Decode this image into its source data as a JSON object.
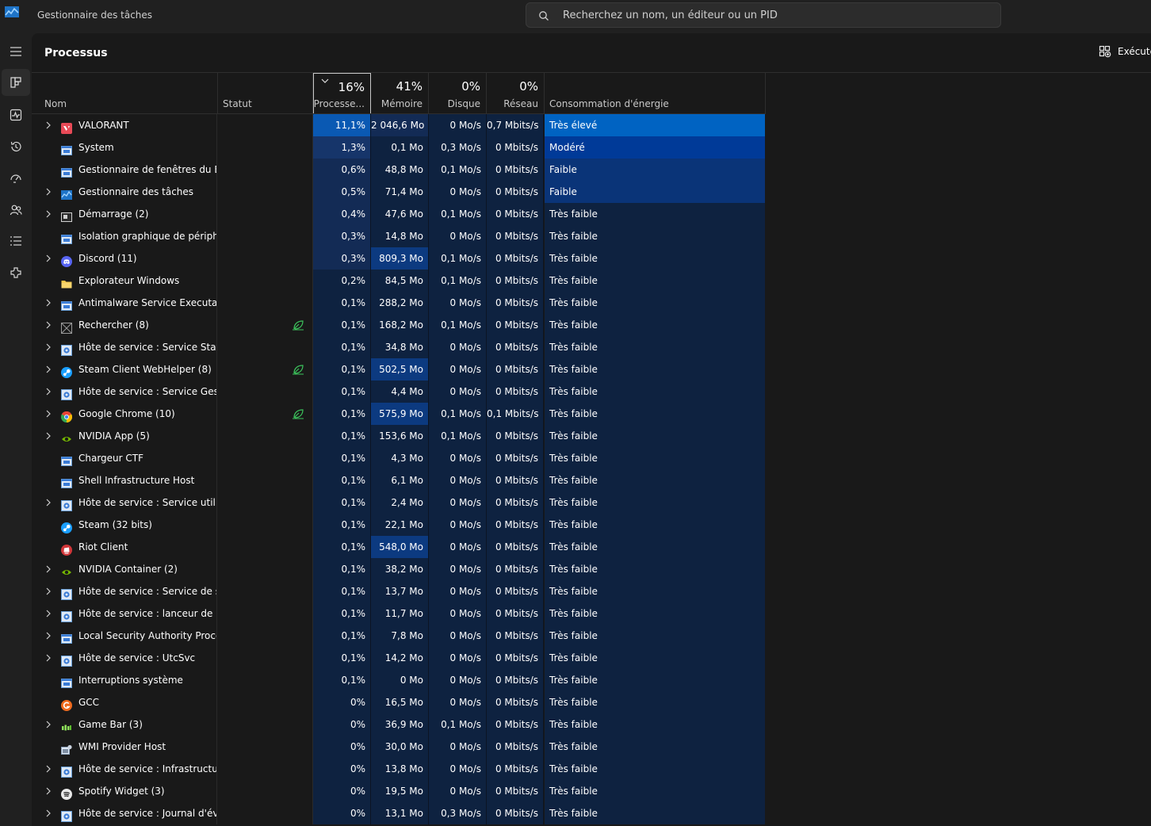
{
  "window": {
    "title": "Gestionnaire des tâches"
  },
  "search": {
    "placeholder": "Recherchez un nom, un éditeur ou un PID"
  },
  "page": {
    "title": "Processus",
    "run_task_label": "Exécute"
  },
  "nav_icons": [
    "hamburger-icon",
    "processes-icon",
    "performance-icon",
    "app-history-icon",
    "startup-apps-icon",
    "users-icon",
    "details-icon",
    "services-icon"
  ],
  "columns": {
    "name": "Nom",
    "status": "Statut",
    "cpu": {
      "pct": "16%",
      "label": "Processe..."
    },
    "memory": {
      "pct": "41%",
      "label": "Mémoire"
    },
    "disk": {
      "pct": "0%",
      "label": "Disque"
    },
    "network": {
      "pct": "0%",
      "label": "Réseau"
    },
    "power": "Consommation d'énergie"
  },
  "colors": {
    "accent": "#0063c2",
    "eco_leaf": "#3cc45c"
  },
  "processes": [
    {
      "name": "VALORANT",
      "expandable": true,
      "icon": "valorant",
      "eco": false,
      "cpu": "11,1%",
      "mem": "2 046,6 Mo",
      "disk": "0 Mo/s",
      "net": "0,7 Mbits/s",
      "power": "Très élevé",
      "cpu_lvl": 4,
      "mem_lvl": 1,
      "pwr_lvl": 4
    },
    {
      "name": "System",
      "expandable": false,
      "icon": "window",
      "eco": false,
      "cpu": "1,3%",
      "mem": "0,1 Mo",
      "disk": "0,3 Mo/s",
      "net": "0 Mbits/s",
      "power": "Modéré",
      "cpu_lvl": 2,
      "mem_lvl": 0,
      "pwr_lvl": 3
    },
    {
      "name": "Gestionnaire de fenêtres du B...",
      "expandable": false,
      "icon": "window",
      "eco": false,
      "cpu": "0,6%",
      "mem": "48,8 Mo",
      "disk": "0,1 Mo/s",
      "net": "0 Mbits/s",
      "power": "Faible",
      "cpu_lvl": 1,
      "mem_lvl": 0,
      "pwr_lvl": 2
    },
    {
      "name": "Gestionnaire des tâches",
      "expandable": true,
      "icon": "taskmgr",
      "eco": false,
      "cpu": "0,5%",
      "mem": "71,4 Mo",
      "disk": "0 Mo/s",
      "net": "0 Mbits/s",
      "power": "Faible",
      "cpu_lvl": 1,
      "mem_lvl": 0,
      "pwr_lvl": 2
    },
    {
      "name": "Démarrage (2)",
      "expandable": true,
      "icon": "startup",
      "eco": false,
      "cpu": "0,4%",
      "mem": "47,6 Mo",
      "disk": "0,1 Mo/s",
      "net": "0 Mbits/s",
      "power": "Très faible",
      "cpu_lvl": 1,
      "mem_lvl": 0,
      "pwr_lvl": 0
    },
    {
      "name": "Isolation graphique de périph...",
      "expandable": false,
      "icon": "window",
      "eco": false,
      "cpu": "0,3%",
      "mem": "14,8 Mo",
      "disk": "0 Mo/s",
      "net": "0 Mbits/s",
      "power": "Très faible",
      "cpu_lvl": 1,
      "mem_lvl": 0,
      "pwr_lvl": 0
    },
    {
      "name": "Discord (11)",
      "expandable": true,
      "icon": "discord",
      "eco": false,
      "cpu": "0,3%",
      "mem": "809,3 Mo",
      "disk": "0,1 Mo/s",
      "net": "0 Mbits/s",
      "power": "Très faible",
      "cpu_lvl": 1,
      "mem_lvl": 3,
      "pwr_lvl": 0
    },
    {
      "name": "Explorateur Windows",
      "expandable": false,
      "icon": "folder",
      "eco": false,
      "cpu": "0,2%",
      "mem": "84,5 Mo",
      "disk": "0,1 Mo/s",
      "net": "0 Mbits/s",
      "power": "Très faible",
      "cpu_lvl": 0,
      "mem_lvl": 0,
      "pwr_lvl": 0
    },
    {
      "name": "Antimalware Service Executable",
      "expandable": true,
      "icon": "window",
      "eco": false,
      "cpu": "0,1%",
      "mem": "288,2 Mo",
      "disk": "0 Mo/s",
      "net": "0 Mbits/s",
      "power": "Très faible",
      "cpu_lvl": 0,
      "mem_lvl": 0,
      "pwr_lvl": 0
    },
    {
      "name": "Rechercher (8)",
      "expandable": true,
      "icon": "search-app",
      "eco": true,
      "cpu": "0,1%",
      "mem": "168,2 Mo",
      "disk": "0,1 Mo/s",
      "net": "0 Mbits/s",
      "power": "Très faible",
      "cpu_lvl": 0,
      "mem_lvl": 0,
      "pwr_lvl": 0
    },
    {
      "name": "Hôte de service : Service State ...",
      "expandable": true,
      "icon": "gear",
      "eco": false,
      "cpu": "0,1%",
      "mem": "34,8 Mo",
      "disk": "0 Mo/s",
      "net": "0 Mbits/s",
      "power": "Très faible",
      "cpu_lvl": 0,
      "mem_lvl": 0,
      "pwr_lvl": 0
    },
    {
      "name": "Steam Client WebHelper (8)",
      "expandable": true,
      "icon": "steam",
      "eco": true,
      "cpu": "0,1%",
      "mem": "502,5 Mo",
      "disk": "0 Mo/s",
      "net": "0 Mbits/s",
      "power": "Très faible",
      "cpu_lvl": 0,
      "mem_lvl": 3,
      "pwr_lvl": 0
    },
    {
      "name": "Hôte de service : Service Gesti...",
      "expandable": true,
      "icon": "gear",
      "eco": false,
      "cpu": "0,1%",
      "mem": "4,4 Mo",
      "disk": "0 Mo/s",
      "net": "0 Mbits/s",
      "power": "Très faible",
      "cpu_lvl": 0,
      "mem_lvl": 0,
      "pwr_lvl": 0
    },
    {
      "name": "Google Chrome (10)",
      "expandable": true,
      "icon": "chrome",
      "eco": true,
      "cpu": "0,1%",
      "mem": "575,9 Mo",
      "disk": "0,1 Mo/s",
      "net": "0,1 Mbits/s",
      "power": "Très faible",
      "cpu_lvl": 0,
      "mem_lvl": 3,
      "pwr_lvl": 0
    },
    {
      "name": "NVIDIA App (5)",
      "expandable": true,
      "icon": "nvidia",
      "eco": false,
      "cpu": "0,1%",
      "mem": "153,6 Mo",
      "disk": "0,1 Mo/s",
      "net": "0 Mbits/s",
      "power": "Très faible",
      "cpu_lvl": 0,
      "mem_lvl": 0,
      "pwr_lvl": 0
    },
    {
      "name": "Chargeur CTF",
      "expandable": false,
      "icon": "window",
      "eco": false,
      "cpu": "0,1%",
      "mem": "4,3 Mo",
      "disk": "0 Mo/s",
      "net": "0 Mbits/s",
      "power": "Très faible",
      "cpu_lvl": 0,
      "mem_lvl": 0,
      "pwr_lvl": 0
    },
    {
      "name": "Shell Infrastructure Host",
      "expandable": false,
      "icon": "window",
      "eco": false,
      "cpu": "0,1%",
      "mem": "6,1 Mo",
      "disk": "0 Mo/s",
      "net": "0 Mbits/s",
      "power": "Très faible",
      "cpu_lvl": 0,
      "mem_lvl": 0,
      "pwr_lvl": 0
    },
    {
      "name": "Hôte de service : Service utilis...",
      "expandable": true,
      "icon": "gear",
      "eco": false,
      "cpu": "0,1%",
      "mem": "2,4 Mo",
      "disk": "0 Mo/s",
      "net": "0 Mbits/s",
      "power": "Très faible",
      "cpu_lvl": 0,
      "mem_lvl": 0,
      "pwr_lvl": 0
    },
    {
      "name": "Steam (32 bits)",
      "expandable": false,
      "icon": "steam",
      "eco": false,
      "cpu": "0,1%",
      "mem": "22,1 Mo",
      "disk": "0 Mo/s",
      "net": "0 Mbits/s",
      "power": "Très faible",
      "cpu_lvl": 0,
      "mem_lvl": 0,
      "pwr_lvl": 0
    },
    {
      "name": "Riot Client",
      "expandable": false,
      "icon": "riot",
      "eco": false,
      "cpu": "0,1%",
      "mem": "548,0 Mo",
      "disk": "0 Mo/s",
      "net": "0 Mbits/s",
      "power": "Très faible",
      "cpu_lvl": 0,
      "mem_lvl": 3,
      "pwr_lvl": 0
    },
    {
      "name": "NVIDIA Container (2)",
      "expandable": true,
      "icon": "nvidia",
      "eco": false,
      "cpu": "0,1%",
      "mem": "38,2 Mo",
      "disk": "0 Mo/s",
      "net": "0 Mbits/s",
      "power": "Très faible",
      "cpu_lvl": 0,
      "mem_lvl": 0,
      "pwr_lvl": 0
    },
    {
      "name": "Hôte de service : Service de str...",
      "expandable": true,
      "icon": "gear",
      "eco": false,
      "cpu": "0,1%",
      "mem": "13,7 Mo",
      "disk": "0 Mo/s",
      "net": "0 Mbits/s",
      "power": "Très faible",
      "cpu_lvl": 0,
      "mem_lvl": 0,
      "pwr_lvl": 0
    },
    {
      "name": "Hôte de service : lanceur de pr...",
      "expandable": true,
      "icon": "gear",
      "eco": false,
      "cpu": "0,1%",
      "mem": "11,7 Mo",
      "disk": "0 Mo/s",
      "net": "0 Mbits/s",
      "power": "Très faible",
      "cpu_lvl": 0,
      "mem_lvl": 0,
      "pwr_lvl": 0
    },
    {
      "name": "Local Security Authority Proce...",
      "expandable": true,
      "icon": "window",
      "eco": false,
      "cpu": "0,1%",
      "mem": "7,8 Mo",
      "disk": "0 Mo/s",
      "net": "0 Mbits/s",
      "power": "Très faible",
      "cpu_lvl": 0,
      "mem_lvl": 0,
      "pwr_lvl": 0
    },
    {
      "name": "Hôte de service : UtcSvc",
      "expandable": true,
      "icon": "gear",
      "eco": false,
      "cpu": "0,1%",
      "mem": "14,2 Mo",
      "disk": "0 Mo/s",
      "net": "0 Mbits/s",
      "power": "Très faible",
      "cpu_lvl": 0,
      "mem_lvl": 0,
      "pwr_lvl": 0
    },
    {
      "name": "Interruptions système",
      "expandable": false,
      "icon": "window",
      "eco": false,
      "cpu": "0,1%",
      "mem": "0 Mo",
      "disk": "0 Mo/s",
      "net": "0 Mbits/s",
      "power": "Très faible",
      "cpu_lvl": 0,
      "mem_lvl": 0,
      "pwr_lvl": 0
    },
    {
      "name": "GCC",
      "expandable": false,
      "icon": "gcc",
      "eco": false,
      "cpu": "0%",
      "mem": "16,5 Mo",
      "disk": "0 Mo/s",
      "net": "0 Mbits/s",
      "power": "Très faible",
      "cpu_lvl": 0,
      "mem_lvl": 0,
      "pwr_lvl": 0
    },
    {
      "name": "Game Bar (3)",
      "expandable": true,
      "icon": "gamebar",
      "eco": false,
      "cpu": "0%",
      "mem": "36,9 Mo",
      "disk": "0,1 Mo/s",
      "net": "0 Mbits/s",
      "power": "Très faible",
      "cpu_lvl": 0,
      "mem_lvl": 0,
      "pwr_lvl": 0
    },
    {
      "name": "WMI Provider Host",
      "expandable": false,
      "icon": "wmi",
      "eco": false,
      "cpu": "0%",
      "mem": "30,0 Mo",
      "disk": "0 Mo/s",
      "net": "0 Mbits/s",
      "power": "Très faible",
      "cpu_lvl": 0,
      "mem_lvl": 0,
      "pwr_lvl": 0
    },
    {
      "name": "Hôte de service : Infrastructur...",
      "expandable": true,
      "icon": "gear",
      "eco": false,
      "cpu": "0%",
      "mem": "13,8 Mo",
      "disk": "0 Mo/s",
      "net": "0 Mbits/s",
      "power": "Très faible",
      "cpu_lvl": 0,
      "mem_lvl": 0,
      "pwr_lvl": 0
    },
    {
      "name": "Spotify Widget (3)",
      "expandable": true,
      "icon": "spotify",
      "eco": false,
      "cpu": "0%",
      "mem": "19,5 Mo",
      "disk": "0 Mo/s",
      "net": "0 Mbits/s",
      "power": "Très faible",
      "cpu_lvl": 0,
      "mem_lvl": 0,
      "pwr_lvl": 0
    },
    {
      "name": "Hôte de service : Journal d'évé...",
      "expandable": true,
      "icon": "gear",
      "eco": false,
      "cpu": "0%",
      "mem": "13,1 Mo",
      "disk": "0,3 Mo/s",
      "net": "0 Mbits/s",
      "power": "Très faible",
      "cpu_lvl": 0,
      "mem_lvl": 0,
      "pwr_lvl": 0
    }
  ]
}
